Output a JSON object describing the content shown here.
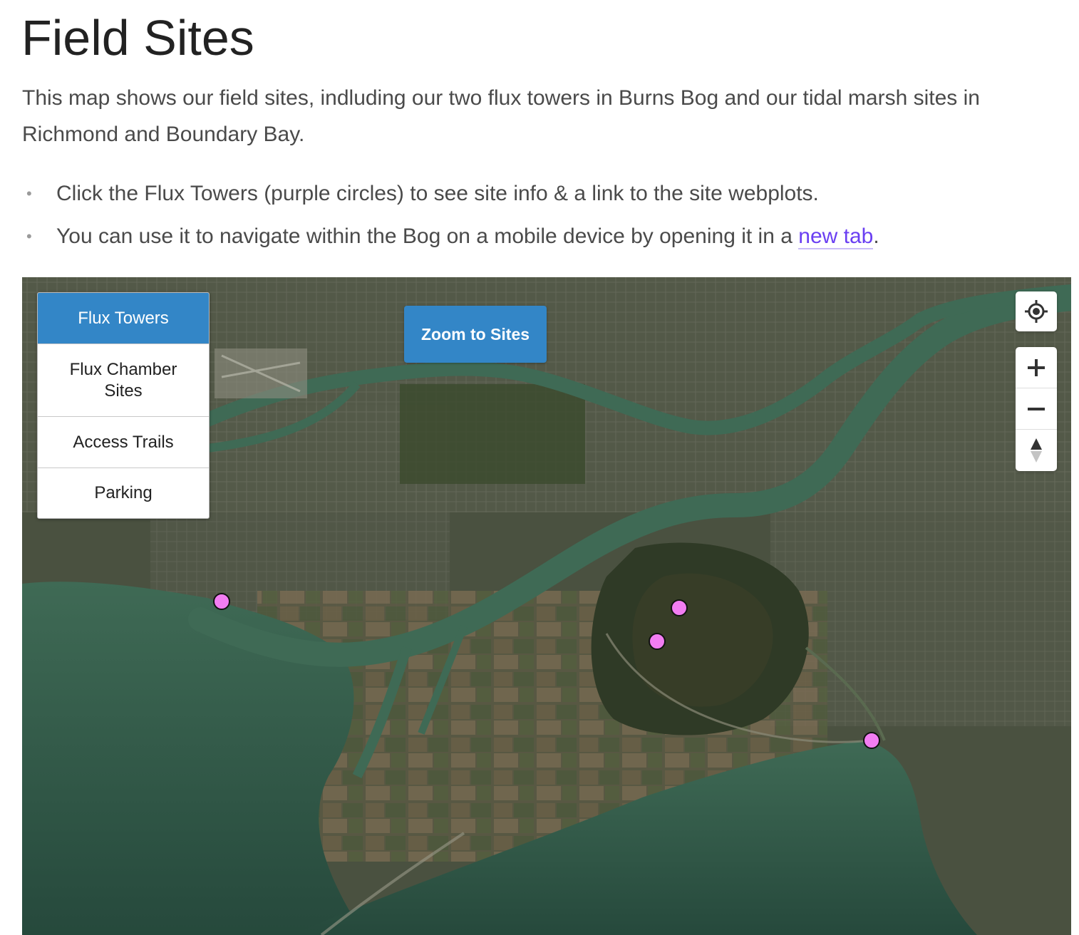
{
  "page": {
    "title": "Field Sites",
    "intro": "This map shows our field sites, indluding our two flux towers in Burns Bog and our tidal marsh sites in Richmond and Boundary Bay.",
    "bullets": [
      {
        "text": "Click the Flux Towers (purple circles) to see site info & a link to the site webplots."
      },
      {
        "text_before": "You can use it to navigate within the Bog on a mobile device by opening it in a ",
        "link_text": "new tab",
        "text_after": "."
      }
    ]
  },
  "map": {
    "layer_buttons": [
      {
        "label": "Flux Towers",
        "active": true
      },
      {
        "label": "Flux Chamber Sites",
        "active": false
      },
      {
        "label": "Access Trails",
        "active": false
      },
      {
        "label": "Parking",
        "active": false
      }
    ],
    "zoom_to_sites_label": "Zoom to Sites",
    "controls": {
      "geolocate_icon": "crosshair-icon",
      "zoom_in_icon": "plus-icon",
      "zoom_out_icon": "minus-icon",
      "compass_icon": "compass-icon"
    },
    "marker_color": "#f27df2",
    "markers": [
      {
        "site": "flux-tower-richmond"
      },
      {
        "site": "flux-tower-burns-bog-1"
      },
      {
        "site": "flux-tower-burns-bog-2"
      },
      {
        "site": "flux-tower-boundary-bay"
      }
    ]
  },
  "colors": {
    "accent": "#3386c7",
    "link": "#6a3ff2",
    "water": "#3f6a55",
    "land": "#4a5140"
  }
}
